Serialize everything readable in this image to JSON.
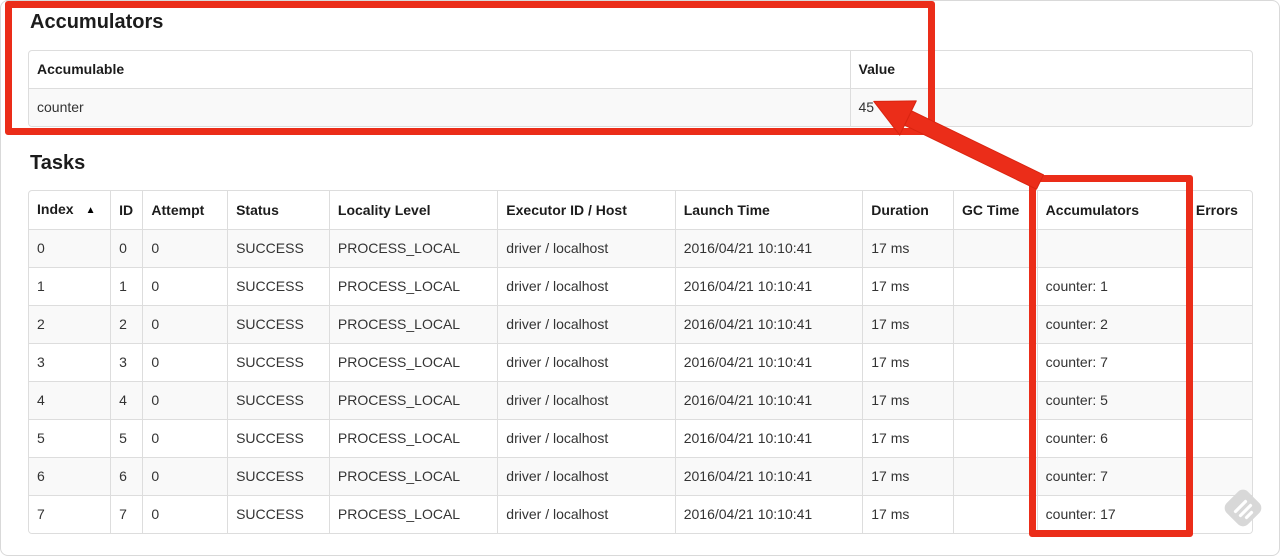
{
  "colors": {
    "annotation_red": "#eb2d19",
    "row_stripe": "#f9f9f9",
    "table_border": "#dddddd",
    "text": "#333333"
  },
  "accumulators_section": {
    "title": "Accumulators",
    "table": {
      "headers": [
        "Accumulable",
        "Value"
      ],
      "rows": [
        [
          "counter",
          "45"
        ]
      ]
    }
  },
  "tasks_section": {
    "title": "Tasks",
    "sort_icon": "▲",
    "table": {
      "headers": [
        "Index",
        "ID",
        "Attempt",
        "Status",
        "Locality Level",
        "Executor ID / Host",
        "Launch Time",
        "Duration",
        "GC Time",
        "Accumulators",
        "Errors"
      ],
      "rows": [
        [
          "0",
          "0",
          "0",
          "SUCCESS",
          "PROCESS_LOCAL",
          "driver / localhost",
          "2016/04/21 10:10:41",
          "17 ms",
          "",
          "",
          ""
        ],
        [
          "1",
          "1",
          "0",
          "SUCCESS",
          "PROCESS_LOCAL",
          "driver / localhost",
          "2016/04/21 10:10:41",
          "17 ms",
          "",
          "counter: 1",
          ""
        ],
        [
          "2",
          "2",
          "0",
          "SUCCESS",
          "PROCESS_LOCAL",
          "driver / localhost",
          "2016/04/21 10:10:41",
          "17 ms",
          "",
          "counter: 2",
          ""
        ],
        [
          "3",
          "3",
          "0",
          "SUCCESS",
          "PROCESS_LOCAL",
          "driver / localhost",
          "2016/04/21 10:10:41",
          "17 ms",
          "",
          "counter: 7",
          ""
        ],
        [
          "4",
          "4",
          "0",
          "SUCCESS",
          "PROCESS_LOCAL",
          "driver / localhost",
          "2016/04/21 10:10:41",
          "17 ms",
          "",
          "counter: 5",
          ""
        ],
        [
          "5",
          "5",
          "0",
          "SUCCESS",
          "PROCESS_LOCAL",
          "driver / localhost",
          "2016/04/21 10:10:41",
          "17 ms",
          "",
          "counter: 6",
          ""
        ],
        [
          "6",
          "6",
          "0",
          "SUCCESS",
          "PROCESS_LOCAL",
          "driver / localhost",
          "2016/04/21 10:10:41",
          "17 ms",
          "",
          "counter: 7",
          ""
        ],
        [
          "7",
          "7",
          "0",
          "SUCCESS",
          "PROCESS_LOCAL",
          "driver / localhost",
          "2016/04/21 10:10:41",
          "17 ms",
          "",
          "counter: 17",
          ""
        ]
      ]
    }
  }
}
